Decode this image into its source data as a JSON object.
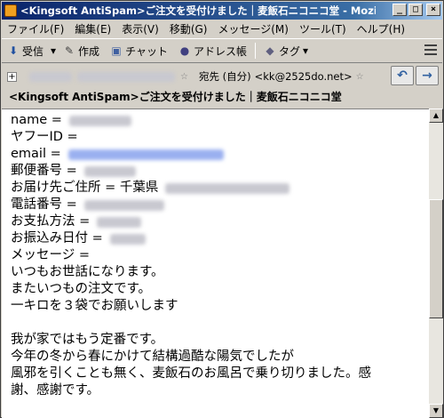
{
  "window": {
    "title": "<Kingsoft AntiSpam>ご注文を受付けました｜麦飯石ニコニコ堂 - Mozilla Thunderbird",
    "buttons": {
      "minimize": "_",
      "maximize": "□",
      "close": "×"
    }
  },
  "menu": [
    "ファイル(F)",
    "編集(E)",
    "表示(V)",
    "移動(G)",
    "メッセージ(M)",
    "ツール(T)",
    "ヘルプ(H)"
  ],
  "toolbar": {
    "receive": {
      "label": "受信",
      "icon": "download-arrow-icon",
      "glyph": "⬇"
    },
    "compose": {
      "label": "作成",
      "icon": "pencil-icon",
      "glyph": "✎"
    },
    "chat": {
      "label": "チャット",
      "icon": "chat-bubble-icon",
      "glyph": "▣"
    },
    "addressbook": {
      "label": "アドレス帳",
      "icon": "person-icon",
      "glyph": "●"
    },
    "tag": {
      "label": "タグ",
      "icon": "tag-icon",
      "glyph": "◆"
    },
    "dropdown": "▾"
  },
  "header": {
    "toggle": "+",
    "to_label": "宛先 (自分)",
    "to_address": "<kk@2525do.net>",
    "subject": "<Kingsoft AntiSpam>ご注文を受付けました｜麦飯石ニコニコ堂",
    "nav_back": "↶",
    "nav_forward": "→"
  },
  "body": {
    "lines": [
      "name =",
      "ヤフーID =",
      "email =",
      "郵便番号 =",
      "お届け先ご住所 = 千葉県",
      "電話番号 =",
      "お支払方法 =",
      "お振込み日付 =",
      "メッセージ =",
      "いつもお世話になります。",
      "またいつもの注文です。",
      "一キロを３袋でお願いします",
      "",
      "我が家ではもう定番です。",
      "今年の冬から春にかけて結構過酷な陽気でしたが",
      "風邪を引くことも無く、麦飯石のお風呂で乗り切りました。感",
      "謝、感謝です。"
    ]
  },
  "scrollbar": {
    "up": "▲",
    "down": "▼"
  },
  "colors": {
    "titlebar_start": "#0a246a",
    "titlebar_end": "#a6caf0",
    "chrome": "#d4d0c8",
    "link_blur": "#7090e0"
  }
}
